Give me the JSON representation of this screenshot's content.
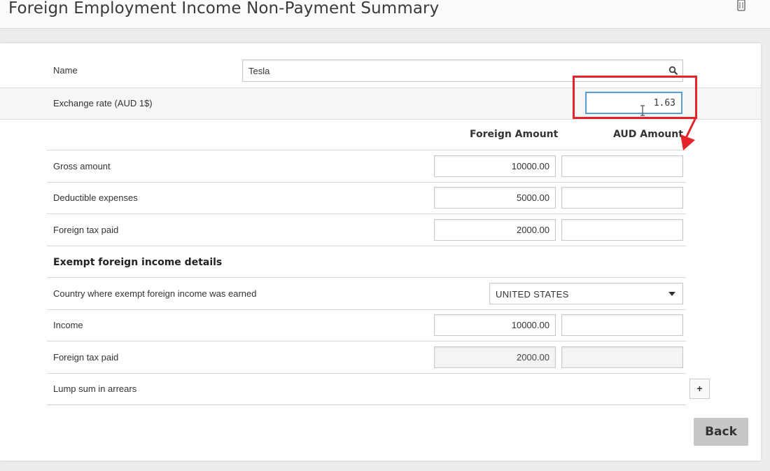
{
  "header": {
    "title": "Foreign Employment Income Non-Payment Summary"
  },
  "name_row": {
    "label": "Name",
    "value": "Tesla"
  },
  "exchange_row": {
    "label": "Exchange rate (AUD 1$)",
    "value": "1.63"
  },
  "columns": {
    "foreign": "Foreign Amount",
    "aud": "AUD Amount"
  },
  "amount_rows": [
    {
      "label": "Gross amount",
      "foreign": "10000.00",
      "aud": ""
    },
    {
      "label": "Deductible expenses",
      "foreign": "5000.00",
      "aud": ""
    },
    {
      "label": "Foreign tax paid",
      "foreign": "2000.00",
      "aud": ""
    }
  ],
  "exempt": {
    "title": "Exempt foreign income details",
    "country_label": "Country where exempt foreign income was earned",
    "country_value": "UNITED STATES",
    "income_label": "Income",
    "income_foreign": "10000.00",
    "income_aud": "",
    "tax_label": "Foreign tax paid",
    "tax_foreign": "2000.00",
    "tax_aud": ""
  },
  "lump_sum": {
    "label": "Lump sum in arrears",
    "add_label": "+"
  },
  "footer": {
    "back_label": "Back"
  },
  "colors": {
    "highlight": "#e3242b",
    "back_button": "#c7c7c7"
  }
}
